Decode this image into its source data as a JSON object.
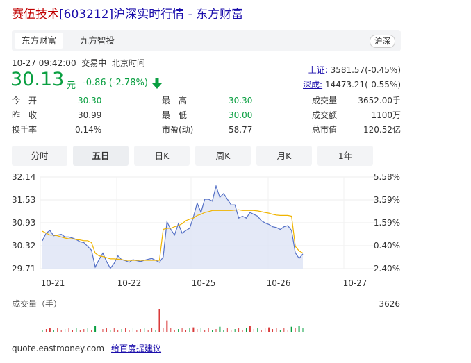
{
  "header": {
    "stock_name": "赛伍技术",
    "stock_code": "[603212]",
    "title_rest": "沪深实时行情 - 东方财富"
  },
  "source_tabs": {
    "active": "东方财富",
    "other": "九方智投",
    "market_tag": "沪深"
  },
  "status": {
    "datetime": "10-27 09:42:00",
    "trade_state": "交易中",
    "timezone": "北京时间"
  },
  "quote": {
    "price": "30.13",
    "unit": "元",
    "change": "-0.86 (-2.78%)"
  },
  "indices": [
    {
      "label": "上证:",
      "value": "3581.57(-0.45%)"
    },
    {
      "label": "深成:",
      "value": "14473.21(-0.55%)"
    }
  ],
  "stats": {
    "open_label": "今　开",
    "open": "30.30",
    "high_label": "最　高",
    "high": "30.30",
    "volume_label": "成交量",
    "volume": "3652.00手",
    "prev_label": "昨　收",
    "prev": "30.99",
    "low_label": "最　低",
    "low": "30.00",
    "amount_label": "成交额",
    "amount": "1100万",
    "turnover_label": "换手率",
    "turnover": "0.14%",
    "pe_label": "市盈(动)",
    "pe": "58.77",
    "mcap_label": "总市值",
    "mcap": "120.52亿"
  },
  "chart_tabs": [
    "分时",
    "五日",
    "日K",
    "周K",
    "月K",
    "1年"
  ],
  "chart_tab_active": "五日",
  "chart_data": {
    "type": "line",
    "x_tick_labels": [
      "10-21",
      "10-22",
      "10-25",
      "10-26",
      "10-27"
    ],
    "y_tick_labels": [
      "32.14",
      "31.53",
      "30.93",
      "30.32",
      "29.71"
    ],
    "y_pct_labels": [
      "5.58%",
      "3.59%",
      "1.59%",
      "-0.40%",
      "-2.40%"
    ],
    "ylim": [
      29.71,
      32.14
    ],
    "prev_close": 30.44,
    "colors": {
      "price": "#5470c6",
      "avg": "#f0b400",
      "fill": "#dde4f5"
    },
    "series": [
      {
        "key": "price",
        "values": [
          30.45,
          30.65,
          30.72,
          30.58,
          30.6,
          30.62,
          30.55,
          30.55,
          30.52,
          30.48,
          30.42,
          30.4,
          30.3,
          30.2,
          29.75,
          29.95,
          30.12,
          29.9,
          29.72,
          29.85,
          30.05,
          29.95,
          29.92,
          29.88,
          29.95,
          29.92,
          29.9,
          29.93,
          29.96,
          29.98,
          29.93,
          29.88,
          30.02,
          30.95,
          30.75,
          30.6,
          30.9,
          30.65,
          30.72,
          30.78,
          31.08,
          31.45,
          31.2,
          31.55,
          31.55,
          31.5,
          31.9,
          31.6,
          31.7,
          31.55,
          31.4,
          31.4,
          31.05,
          31.1,
          31.05,
          31.2,
          31.15,
          31.1,
          30.98,
          30.92,
          30.88,
          30.82,
          30.8,
          30.75,
          30.82,
          30.85,
          30.72,
          30.13,
          29.98,
          30.1
        ]
      },
      {
        "key": "avg",
        "values": [
          30.7,
          30.65,
          30.6,
          30.6,
          30.58,
          30.55,
          30.52,
          30.5,
          30.5,
          30.48,
          30.47,
          30.45,
          30.45,
          30.4,
          30.12,
          30.05,
          30.03,
          30.0,
          29.97,
          29.97,
          29.96,
          29.95,
          29.93,
          29.93,
          29.93,
          29.93,
          29.93,
          29.93,
          29.93,
          29.93,
          29.93,
          29.93,
          30.75,
          30.78,
          30.78,
          30.82,
          30.85,
          30.9,
          30.98,
          31.02,
          31.05,
          31.12,
          31.15,
          31.2,
          31.22,
          31.25,
          31.25,
          31.25,
          31.25,
          31.25,
          31.25,
          31.26,
          31.27,
          31.25,
          31.25,
          31.25,
          31.25,
          31.24,
          31.22,
          31.2,
          31.18,
          31.15,
          31.13,
          31.12,
          31.12,
          31.12,
          31.1,
          30.3,
          30.18,
          30.12
        ]
      }
    ],
    "volume_label": "成交量（手）",
    "volume_max_label": "3626",
    "volume_max": 3626,
    "volume_spikes": [
      {
        "i": 2,
        "v": 600,
        "up": true
      },
      {
        "i": 14,
        "v": 900,
        "up": false
      },
      {
        "i": 31,
        "v": 3626,
        "up": true
      },
      {
        "i": 33,
        "v": 1800,
        "up": true
      },
      {
        "i": 40,
        "v": 700,
        "up": true
      },
      {
        "i": 47,
        "v": 800,
        "up": false
      },
      {
        "i": 55,
        "v": 900,
        "up": true
      },
      {
        "i": 60,
        "v": 700,
        "up": true
      },
      {
        "i": 66,
        "v": 800,
        "up": false
      },
      {
        "i": 68,
        "v": 900,
        "up": false
      }
    ],
    "volume_colors": {
      "up": "#d93a3a",
      "down": "#0a9f41"
    }
  },
  "footer": {
    "site": "quote.eastmoney.com",
    "feedback": "给百度提建议"
  }
}
